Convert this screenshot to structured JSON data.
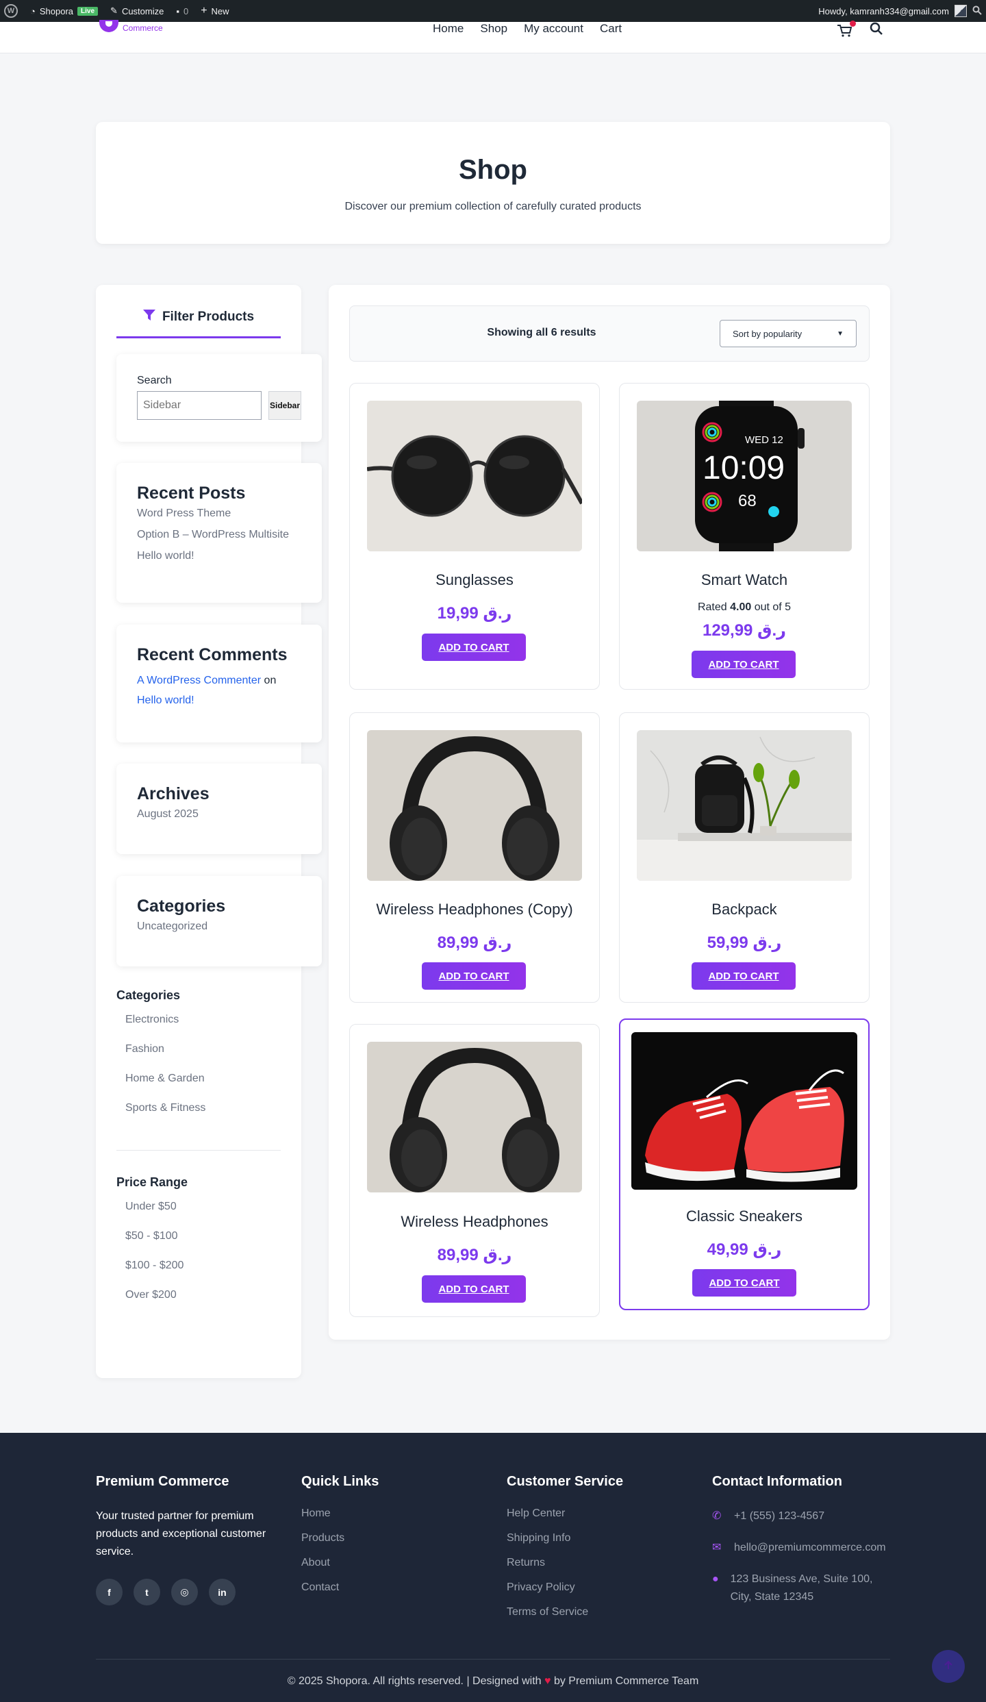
{
  "admin_bar": {
    "site_name": "Shopora",
    "live_badge": "Live",
    "customize": "Customize",
    "comments_count": "0",
    "new": "New",
    "howdy": "Howdy, kamranh334@gmail.com"
  },
  "header": {
    "logo_text": "Commerce",
    "nav": [
      "Home",
      "Shop",
      "My account",
      "Cart"
    ]
  },
  "hero": {
    "title": "Shop",
    "subtitle": "Discover our premium collection of carefully curated products"
  },
  "sidebar": {
    "filter_title": "Filter Products",
    "search_label": "Search",
    "search_placeholder": "Sidebar",
    "search_button": "Sidebar",
    "recent_posts_title": "Recent Posts",
    "recent_posts": [
      "Word Press Theme",
      "Option B – WordPress Multisite",
      "Hello world!"
    ],
    "recent_comments_title": "Recent Comments",
    "comment_author": "A WordPress Commenter",
    "comment_on": "on",
    "comment_post": "Hello world!",
    "archives_title": "Archives",
    "archives": [
      "August 2025"
    ],
    "categories_widget_title": "Categories",
    "categories_widget": [
      "Uncategorized"
    ],
    "categories_title": "Categories",
    "categories": [
      "Electronics",
      "Fashion",
      "Home & Garden",
      "Sports & Fitness"
    ],
    "price_title": "Price Range",
    "price_ranges": [
      "Under $50",
      "$50 - $100",
      "$100 - $200",
      "Over $200"
    ]
  },
  "shop": {
    "result_count": "Showing all 6 results",
    "sort_value": "Sort by popularity",
    "add_to_cart": "ADD TO CART",
    "products": [
      {
        "name": "Sunglasses",
        "price": "ر.ق 19,99"
      },
      {
        "name": "Smart Watch",
        "price": "ر.ق 129,99",
        "rating_prefix": "Rated",
        "rating": "4.00",
        "rating_suffix": "out of 5"
      },
      {
        "name": "Wireless Headphones (Copy)",
        "price": "ر.ق 89,99"
      },
      {
        "name": "Backpack",
        "price": "ر.ق 59,99"
      },
      {
        "name": "Wireless Headphones",
        "price": "ر.ق 89,99"
      },
      {
        "name": "Classic Sneakers",
        "price": "ر.ق 49,99"
      }
    ],
    "watch_face": {
      "date": "WED 12",
      "time": "10:09",
      "value": "68"
    }
  },
  "footer": {
    "brand_title": "Premium Commerce",
    "tagline": "Your trusted partner for premium products and exceptional customer service.",
    "quick_links_title": "Quick Links",
    "quick_links": [
      "Home",
      "Products",
      "About",
      "Contact"
    ],
    "service_title": "Customer Service",
    "service_links": [
      "Help Center",
      "Shipping Info",
      "Returns",
      "Privacy Policy",
      "Terms of Service"
    ],
    "contact_title": "Contact Information",
    "phone": "+1 (555) 123-4567",
    "email": "hello@premiumcommerce.com",
    "address": "123 Business Ave, Suite 100, City, State 12345",
    "copyright_prefix": "© 2025 Shopora. All rights reserved. | Designed with",
    "copyright_suffix": "by Premium Commerce Team"
  },
  "colors": {
    "accent": "#7c3aed",
    "footer_bg": "#1e2637",
    "admin_bar": "#1d2327"
  }
}
